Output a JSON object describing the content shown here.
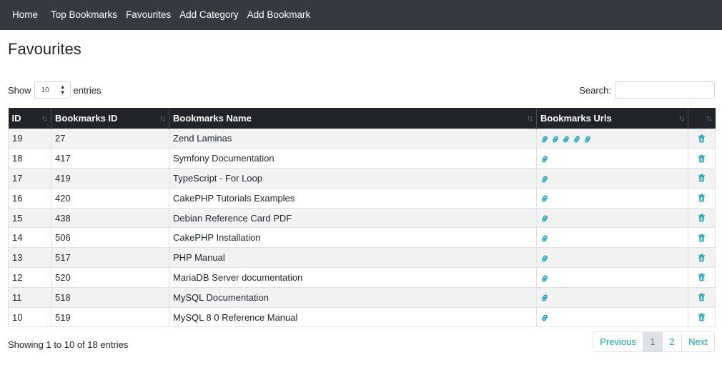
{
  "nav": {
    "items": [
      "Home",
      "Top Bookmarks",
      "Favourites",
      "Add Category",
      "Add Bookmark"
    ]
  },
  "page": {
    "title": "Favourites"
  },
  "length": {
    "show_label": "Show",
    "value": "10",
    "entries_label": "entries"
  },
  "search": {
    "label": "Search:",
    "value": "",
    "placeholder": ""
  },
  "table": {
    "headers": [
      "ID",
      "Bookmarks ID",
      "Bookmarks Name",
      "Bookmarks Urls",
      ""
    ],
    "rows": [
      {
        "id": "19",
        "bookmark_id": "27",
        "name": "Zend Laminas",
        "url_count": 5
      },
      {
        "id": "18",
        "bookmark_id": "417",
        "name": "Symfony Documentation",
        "url_count": 1
      },
      {
        "id": "17",
        "bookmark_id": "419",
        "name": "TypeScript - For Loop",
        "url_count": 1
      },
      {
        "id": "16",
        "bookmark_id": "420",
        "name": "CakePHP Tutorials Examples",
        "url_count": 1
      },
      {
        "id": "15",
        "bookmark_id": "438",
        "name": "Debian Reference Card PDF",
        "url_count": 1
      },
      {
        "id": "14",
        "bookmark_id": "506",
        "name": "CakePHP Installation",
        "url_count": 1
      },
      {
        "id": "13",
        "bookmark_id": "517",
        "name": "PHP Manual",
        "url_count": 1
      },
      {
        "id": "12",
        "bookmark_id": "520",
        "name": "MariaDB Server documentation",
        "url_count": 1
      },
      {
        "id": "11",
        "bookmark_id": "518",
        "name": "MySQL Documentation",
        "url_count": 1
      },
      {
        "id": "10",
        "bookmark_id": "519",
        "name": "MySQL 8 0 Reference Manual",
        "url_count": 1
      }
    ]
  },
  "footer": {
    "info": "Showing 1 to 10 of 18 entries",
    "pagination": {
      "previous": "Previous",
      "pages": [
        "1",
        "2"
      ],
      "active": "1",
      "next": "Next"
    }
  },
  "icons": {
    "url": "link-icon",
    "delete": "trash-icon",
    "sort": "sort-icon"
  },
  "colors": {
    "navbar": "#343a40",
    "header": "#212529",
    "accent": "#17a2b8",
    "stripe": "#f2f2f2"
  }
}
